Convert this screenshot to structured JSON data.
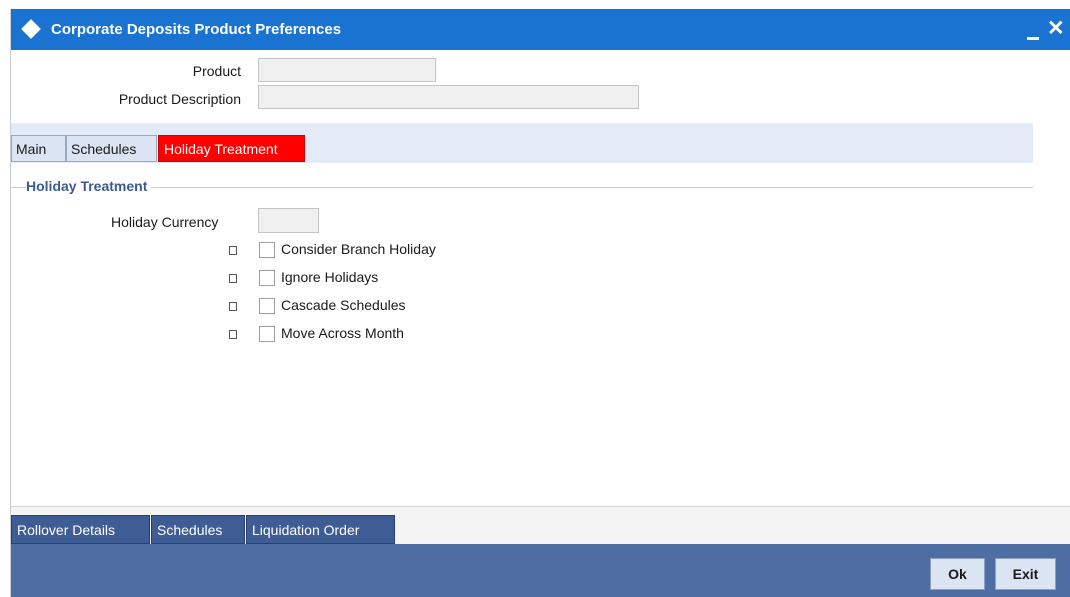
{
  "window": {
    "title": "Corporate Deposits Product Preferences",
    "minimize_glyph": "",
    "close_glyph": "✕"
  },
  "header": {
    "product_label": "Product",
    "product_value": "",
    "description_label": "Product Description",
    "description_value": ""
  },
  "tabs": [
    {
      "label": "Main",
      "active": false
    },
    {
      "label": "Schedules",
      "active": false
    },
    {
      "label": "Holiday Treatment",
      "active": true
    }
  ],
  "holiday_treatment": {
    "section_title": "Holiday Treatment",
    "currency_label": "Holiday Currency",
    "currency_value": "",
    "options": [
      {
        "label": "Consider Branch Holiday",
        "checked": false
      },
      {
        "label": "Ignore Holidays",
        "checked": false
      },
      {
        "label": "Cascade Schedules",
        "checked": false
      },
      {
        "label": "Move Across Month",
        "checked": false
      }
    ]
  },
  "footer_tabs": [
    {
      "label": "Rollover Details"
    },
    {
      "label": "Schedules"
    },
    {
      "label": "Liquidation Order"
    }
  ],
  "actions": {
    "ok_label": "Ok",
    "exit_label": "Exit"
  },
  "colors": {
    "titlebar": "#1a73d0",
    "active_tab": "#ff0000",
    "footer_tab": "#3f5d95",
    "bottombar": "#4e6ea3"
  }
}
